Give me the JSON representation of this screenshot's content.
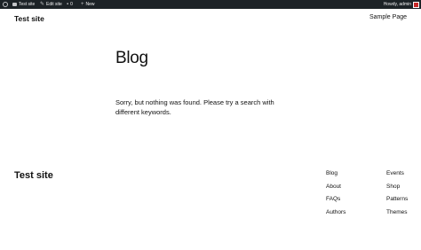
{
  "admin_bar": {
    "site_label": "Test site",
    "edit_label": "Edit site",
    "comments_count": "0",
    "new_label": "New",
    "greeting": "Howdy, admin"
  },
  "header": {
    "site_title": "Test site",
    "nav": [
      "Sample Page"
    ]
  },
  "main": {
    "heading": "Blog",
    "message": "Sorry, but nothing was found. Please try a search with different keywords."
  },
  "footer": {
    "site_title": "Test site",
    "col1": [
      "Blog",
      "About",
      "FAQs",
      "Authors"
    ],
    "col2": [
      "Events",
      "Shop",
      "Patterns",
      "Themes"
    ]
  },
  "colors": {
    "admin_bar_bg": "#1d2327",
    "text": "#111111",
    "avatar": "#c62828"
  }
}
